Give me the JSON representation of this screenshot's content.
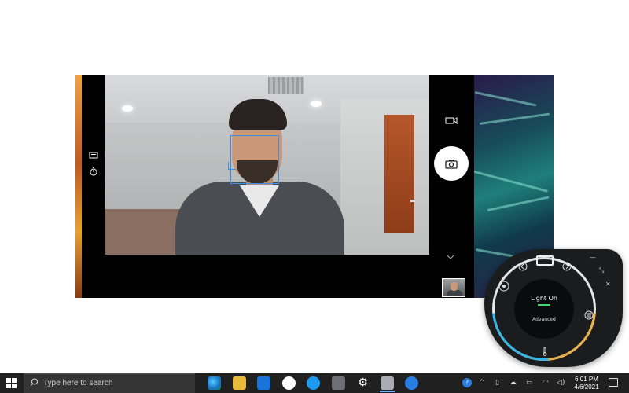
{
  "colors": {
    "face_box": "#3a8ee6",
    "dial_indicator": "#3fd66a",
    "warm": "#e8b04a",
    "cool": "#37b6e6",
    "taskbar": "#202020"
  },
  "camera": {
    "left_icons": [
      "hdr-icon",
      "timer-icon"
    ],
    "right_icons": [
      "video-icon",
      "shutter-icon",
      "chevron-down-icon"
    ]
  },
  "dial": {
    "title": "Light On",
    "advanced": "Advanced",
    "icons": [
      "brightness-icon",
      "back-arrow-icon",
      "forward-arrow-icon",
      "menu-icon",
      "thermometer-icon",
      "minimize-icon",
      "close-icon",
      "shrink-icon"
    ]
  },
  "taskbar": {
    "search_placeholder": "Type here to search",
    "apps": [
      "edge-icon",
      "file-explorer-icon",
      "mail-icon",
      "github-icon",
      "twitter-icon",
      "calculator-icon",
      "settings-icon",
      "camera-icon",
      "app-icon"
    ],
    "tray": [
      "help-icon",
      "chevron-up-icon",
      "battery-icon",
      "cloud-icon",
      "display-icon",
      "wifi-icon",
      "volume-icon"
    ],
    "time": "6:01 PM",
    "date": "4/6/2021"
  }
}
